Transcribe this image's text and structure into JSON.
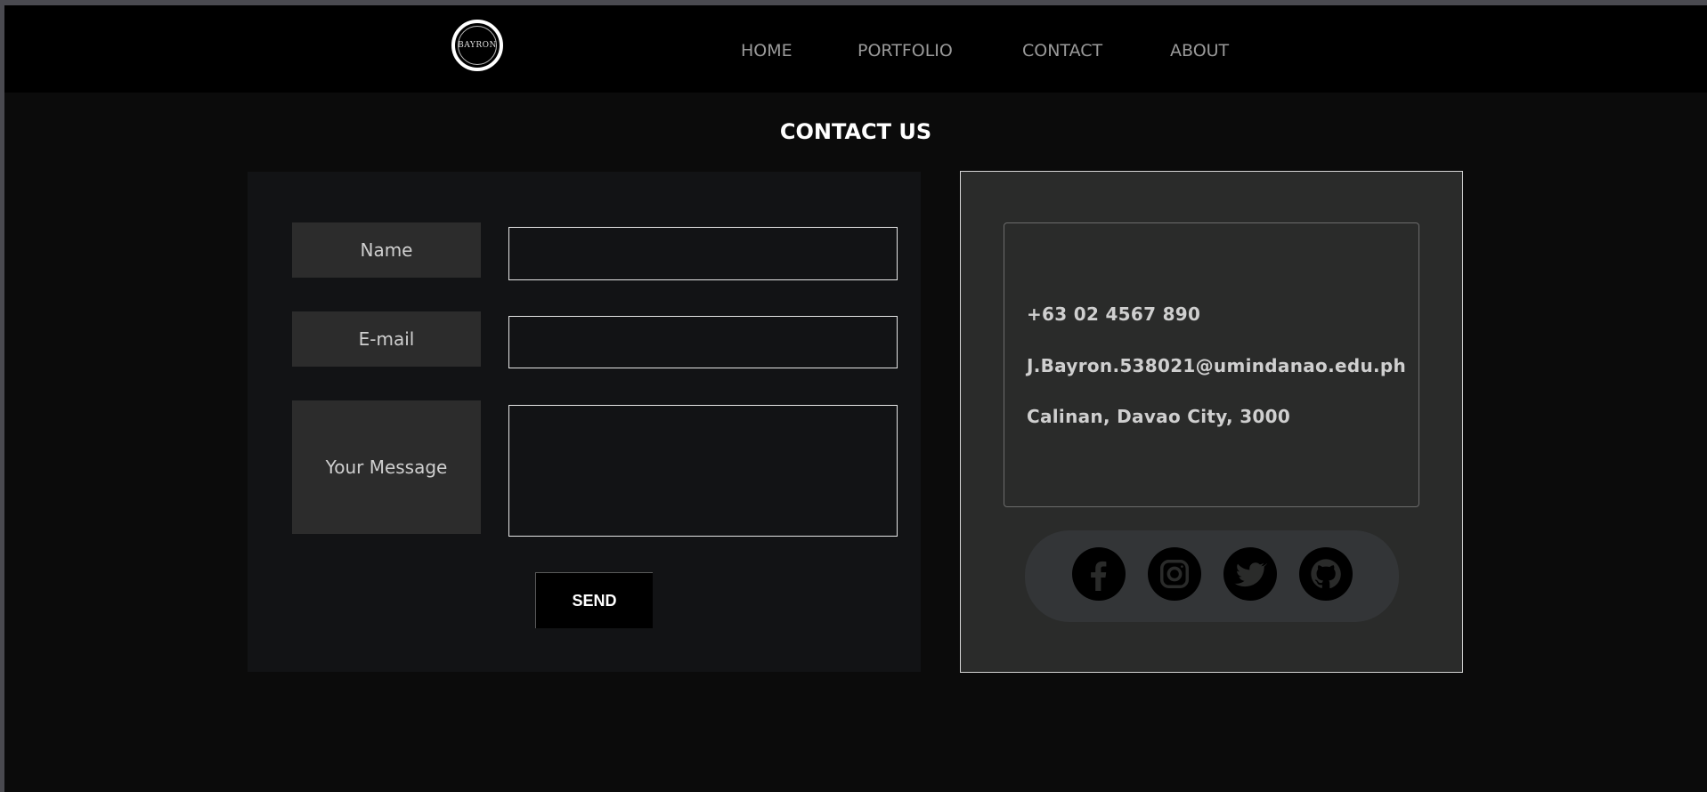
{
  "header": {
    "logo_text": "BAYRON",
    "nav": [
      {
        "label": "HOME"
      },
      {
        "label": "PORTFOLIO"
      },
      {
        "label": "CONTACT"
      },
      {
        "label": "ABOUT"
      }
    ]
  },
  "page": {
    "title": "CONTACT US"
  },
  "form": {
    "name_label": "Name",
    "email_label": "E-mail",
    "message_label": "Your Message",
    "name_value": "",
    "email_value": "",
    "message_value": "",
    "send_label": "SEND"
  },
  "contact_info": {
    "phone": "+63 02 4567 890",
    "email": "J.Bayron.538021@umindanao.edu.ph",
    "address": "Calinan, Davao City, 3000"
  },
  "social": [
    {
      "icon": "facebook-icon"
    },
    {
      "icon": "instagram-icon"
    },
    {
      "icon": "twitter-icon"
    },
    {
      "icon": "github-icon"
    }
  ]
}
